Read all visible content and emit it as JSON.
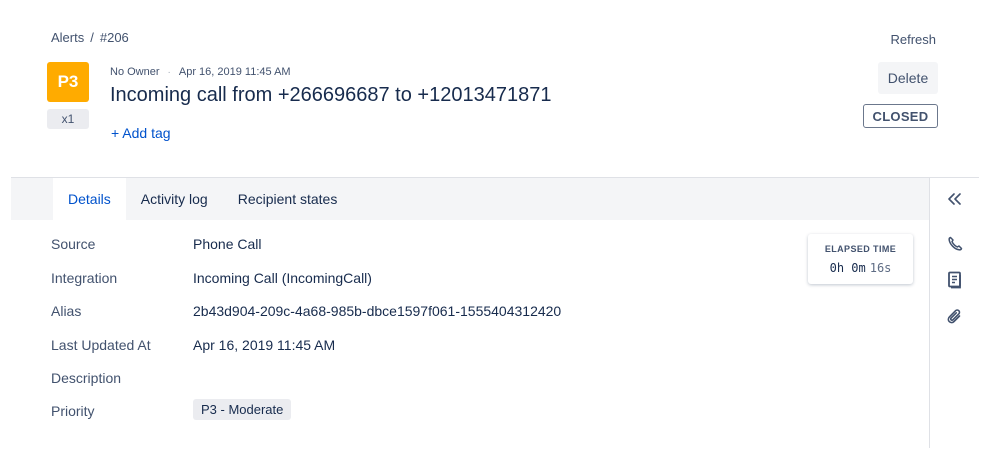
{
  "breadcrumb": {
    "root": "Alerts",
    "separator": "/",
    "current": "#206"
  },
  "header": {
    "refresh_label": "Refresh",
    "priority_badge": "P3",
    "count_badge": "x1",
    "owner": "No Owner",
    "meta_separator": "·",
    "created": "Apr 16, 2019 11:45 AM",
    "title": "Incoming call from +266696687 to +12013471871",
    "add_tag_label": "+ Add tag",
    "delete_label": "Delete",
    "status": "CLOSED"
  },
  "tabs": [
    {
      "label": "Details",
      "active": true
    },
    {
      "label": "Activity log",
      "active": false
    },
    {
      "label": "Recipient states",
      "active": false
    }
  ],
  "details": [
    {
      "label": "Source",
      "value": "Phone Call"
    },
    {
      "label": "Integration",
      "value": "Incoming Call (IncomingCall)"
    },
    {
      "label": "Alias",
      "value": "2b43d904-209c-4a68-985b-dbce1597f061-1555404312420"
    },
    {
      "label": "Last Updated At",
      "value": "Apr 16, 2019 11:45 AM"
    },
    {
      "label": "Description",
      "value": ""
    },
    {
      "label": "Priority",
      "value": "P3 - Moderate"
    }
  ],
  "elapsed": {
    "label": "ELAPSED TIME",
    "hm": "0h 0m",
    "s": "16s"
  },
  "sidebar_icons": [
    "collapse-icon",
    "phone-icon",
    "notes-icon",
    "attachment-icon"
  ],
  "colors": {
    "priority_p3": "#ffab00",
    "link": "#0052cc",
    "text": "#172b4d"
  }
}
